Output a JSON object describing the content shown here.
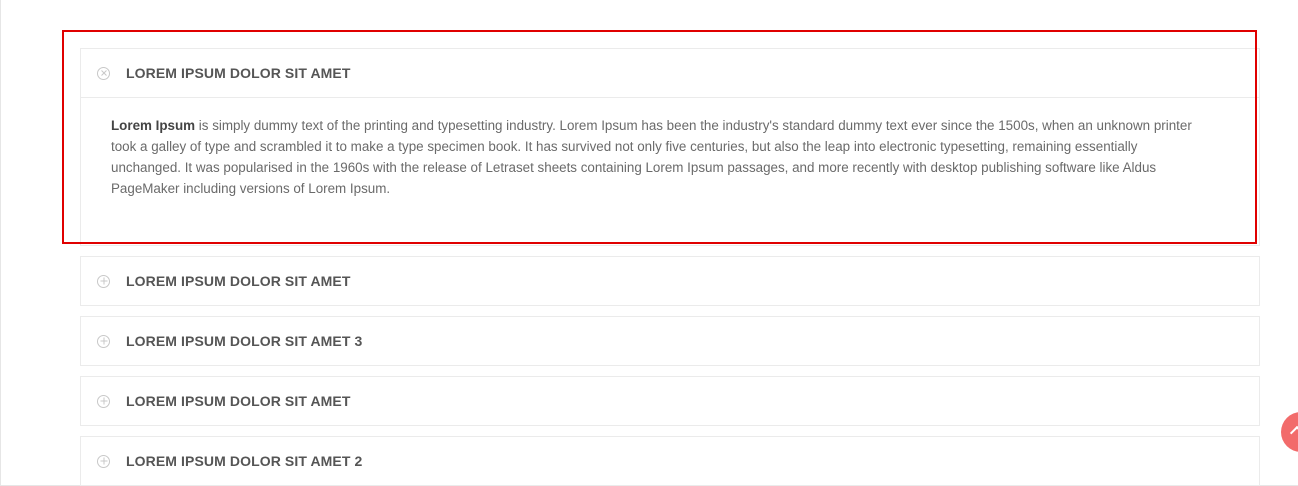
{
  "accordion": {
    "items": [
      {
        "title": "LOREM IPSUM DOLOR SIT AMET",
        "expanded": true,
        "icon": "close-circle-icon",
        "body_bold": "Lorem Ipsum",
        "body_text": " is simply dummy text of the printing and typesetting industry. Lorem Ipsum has been the industry's standard dummy text ever since the 1500s, when an unknown printer took a galley of type and scrambled it to make a type specimen book. It has survived not only five centuries, but also the leap into electronic typesetting, remaining essentially unchanged. It was popularised in the 1960s with the release of Letraset sheets containing Lorem Ipsum passages, and more recently with desktop publishing software like Aldus PageMaker including versions of Lorem Ipsum."
      },
      {
        "title": "LOREM IPSUM DOLOR SIT AMET",
        "expanded": false,
        "icon": "plus-circle-icon"
      },
      {
        "title": "LOREM IPSUM DOLOR SIT AMET 3",
        "expanded": false,
        "icon": "plus-circle-icon"
      },
      {
        "title": "LOREM IPSUM DOLOR SIT AMET",
        "expanded": false,
        "icon": "plus-circle-icon"
      },
      {
        "title": "LOREM IPSUM DOLOR SIT AMET 2",
        "expanded": false,
        "icon": "plus-circle-icon"
      }
    ]
  },
  "colors": {
    "highlight": "#e00000",
    "scroll_top": "#f26b6b",
    "title": "#555555",
    "body": "#6a6a6a"
  },
  "scroll_top": {
    "icon": "chevron-up-icon"
  }
}
